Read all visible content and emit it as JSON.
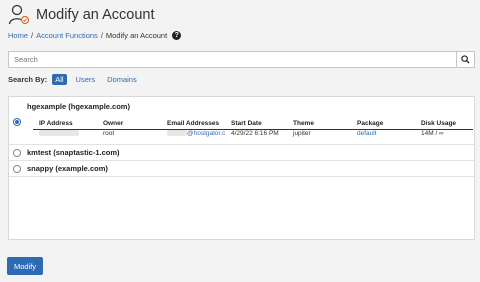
{
  "header": {
    "title": "Modify an Account",
    "icon": "user-edit-icon"
  },
  "breadcrumb": {
    "home": "Home",
    "sep": "/",
    "section": "Account Functions",
    "current": "Modify an Account",
    "help": "?"
  },
  "search": {
    "placeholder": "Search",
    "button_icon": "search-icon"
  },
  "search_by": {
    "label": "Search By:",
    "options": [
      "All",
      "Users",
      "Domains"
    ],
    "selected": "All"
  },
  "table_headers": [
    "IP Address",
    "Owner",
    "Email Addresses",
    "Start Date",
    "Theme",
    "Package",
    "Disk Usage"
  ],
  "accounts": [
    {
      "title": "hgexample (hgexample.com)",
      "selected": true,
      "ip": "",
      "owner": "root",
      "email": "@hostgator.c",
      "start_date": "4/29/22 6:16 PM",
      "theme": "jupiter",
      "package": "default",
      "disk_usage": "14M / ∞"
    },
    {
      "title": "kmtest (snaptastic-1.com)",
      "selected": false
    },
    {
      "title": "snappy (example.com)",
      "selected": false
    }
  ],
  "actions": {
    "modify": "Modify"
  },
  "colors": {
    "accent": "#2d6cb5"
  }
}
